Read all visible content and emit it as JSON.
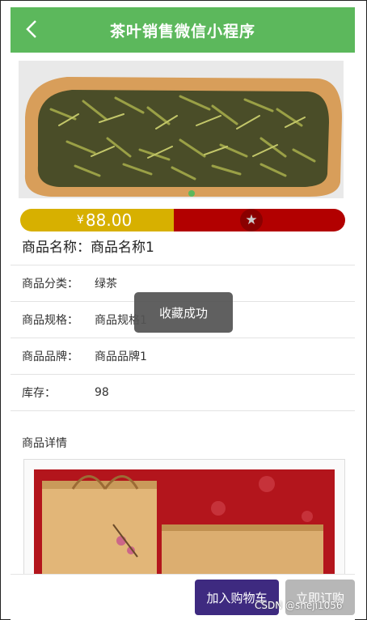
{
  "header": {
    "title": "茶叶销售微信小程序",
    "back_icon": "chevron-left-icon"
  },
  "product": {
    "currency_symbol": "¥",
    "price": "88.00",
    "name_label": "商品名称：",
    "name_value": "商品名称1",
    "favorite_icon": "star-icon",
    "attributes": [
      {
        "key": "商品分类：",
        "value": "绿茶"
      },
      {
        "key": "商品规格：",
        "value": "商品规格1"
      },
      {
        "key": "商品品牌：",
        "value": "商品品牌1"
      },
      {
        "key": "库存：",
        "value": "98"
      }
    ],
    "detail_title": "商品详情"
  },
  "toast": {
    "message": "收藏成功"
  },
  "actions": {
    "add_to_cart": "加入购物车",
    "buy_now": "立即订购"
  },
  "watermark": "CSDN @sheji1056",
  "colors": {
    "nav": "#5cb85c",
    "price_left": "#d7b000",
    "price_right": "#b20000",
    "cart_button": "#3e2a80",
    "buy_button": "#b7b7b7"
  }
}
